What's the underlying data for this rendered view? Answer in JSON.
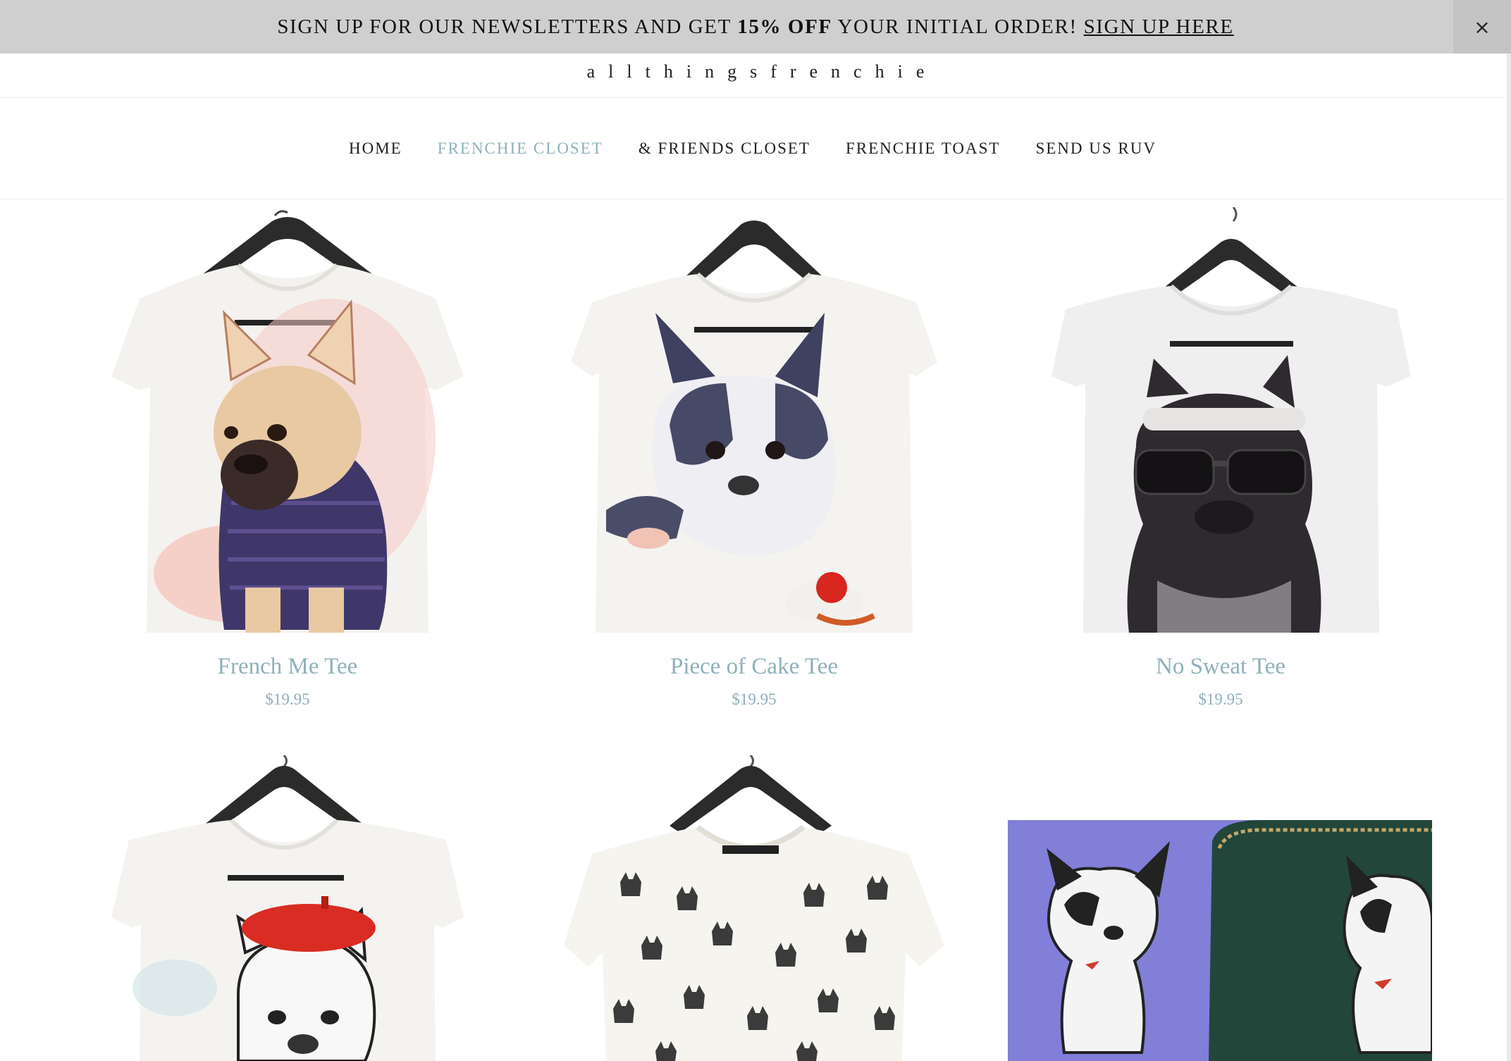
{
  "announcement": {
    "text_before": "SIGN UP FOR OUR NEWSLETTERS AND GET ",
    "highlight": "15% OFF",
    "text_after": " YOUR INITIAL ORDER! ",
    "link_label": "SIGN UP HERE",
    "close_icon": "close-icon",
    "close_glyph": "×"
  },
  "brand": {
    "logo_text": "allthingsfrenchie"
  },
  "nav": {
    "items": [
      {
        "label": "HOME",
        "active": false
      },
      {
        "label": "FRENCHIE CLOSET",
        "active": true
      },
      {
        "label": "& FRIENDS CLOSET",
        "active": false
      },
      {
        "label": "FRENCHIE TOAST",
        "active": false
      },
      {
        "label": "SEND US RUV",
        "active": false
      }
    ]
  },
  "products": [
    {
      "title": "French Me Tee",
      "price": "$19.95",
      "art": "watercolor-frenchie-sweater"
    },
    {
      "title": "Piece of Cake Tee",
      "price": "$19.95",
      "art": "watercolor-boston-cake"
    },
    {
      "title": "No Sweat Tee",
      "price": "$19.95",
      "art": "frenchie-sunglasses-headband"
    },
    {
      "title": "",
      "price": "",
      "art": "frenchie-red-beret"
    },
    {
      "title": "",
      "price": "",
      "art": "frenchie-pattern-print"
    },
    {
      "title": "",
      "price": "",
      "art": "frenchie-wallets"
    }
  ],
  "colors": {
    "accent": "#8fb0ba",
    "announce_bg": "#cfcfcf",
    "text": "#222222"
  }
}
